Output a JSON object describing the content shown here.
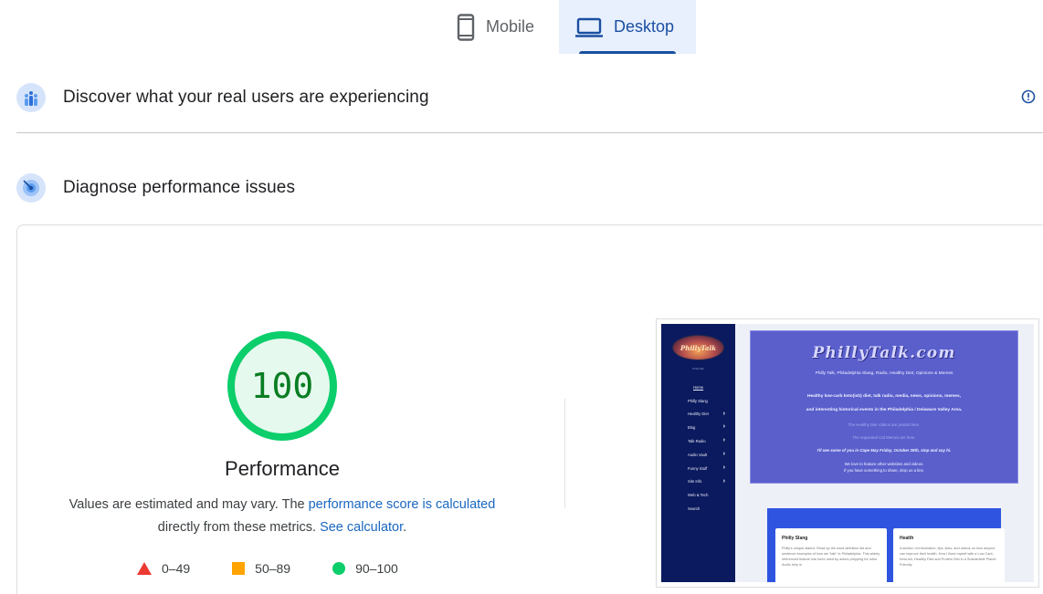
{
  "tabs": [
    {
      "label": "Mobile",
      "icon": "smartphone-icon",
      "active": false
    },
    {
      "label": "Desktop",
      "icon": "laptop-icon",
      "active": true
    }
  ],
  "sections": {
    "discover": {
      "title": "Discover what your real users are experiencing",
      "icon": "crux-users-icon"
    },
    "diagnose": {
      "title": "Diagnose performance issues",
      "icon": "lighthouse-radar-icon"
    }
  },
  "performance": {
    "score": "100",
    "title": "Performance",
    "desc_prefix": "Values are estimated and may vary. The ",
    "score_link": "performance score is calculated",
    "desc_middle": "directly from these metrics. ",
    "calc_link": "See calculator",
    "desc_suffix": "."
  },
  "legend": [
    {
      "range": "0–49",
      "shape": "triangle",
      "color": "#eb3a32"
    },
    {
      "range": "50–89",
      "shape": "square",
      "color": "#ffa400"
    },
    {
      "range": "90–100",
      "shape": "circle",
      "color": "#0cce6b"
    }
  ],
  "colors": {
    "accent": "#1a4fa1",
    "pass": "#0cce6b",
    "pass_text": "#0a7d22",
    "average": "#ffa400",
    "fail": "#eb3a32"
  },
  "site_preview": {
    "logo_text": "PhillyTalk",
    "logo_sub": "PhillyTalk",
    "nav": [
      {
        "label": "Home",
        "chevron": false
      },
      {
        "label": "Philly Slang",
        "chevron": false
      },
      {
        "label": "Healthy Diet",
        "chevron": true
      },
      {
        "label": "Blog",
        "chevron": true
      },
      {
        "label": "Talk Radio",
        "chevron": true
      },
      {
        "label": "Audio Vault",
        "chevron": true
      },
      {
        "label": "Funny Stuff",
        "chevron": true
      },
      {
        "label": "Site Info",
        "chevron": true
      },
      {
        "label": "Web & Tech",
        "chevron": false
      },
      {
        "label": "Search",
        "chevron": false
      }
    ],
    "hero_title": "PhillyTalk.com",
    "hero_subtitle": "Philly Talk, Philadelphia Slang, Radio, Healthy Diet, Opinions & Memes",
    "hero_bold_1": "Healthy low-carb keto(ish) diet, talk radio, media, news, opinions, memes,",
    "hero_bold_2": "and interesting historical events in the Philadelphia / Delaware Valley Area.",
    "hero_link_1": "The Healthy Diet Videos are posted here.",
    "hero_link_2": "The requested Cat Memes are here.",
    "hero_italic": "I'll see some of you in Cape May Friday, October 28th, stop and say hi.",
    "hero_contact_1": "We love to feature other websites and videos.",
    "hero_contact_2": "If you have something to share, drop us a line.",
    "cards": [
      {
        "title": "Philly Slang",
        "text": "Philly's unique dialect. Read up the word definition list and sentence examples of how we \"talk\" in Philadelphia. This widely referenced feature has been used by actors prepping for roles. Audio help is"
      },
      {
        "title": "Health",
        "text": "A section of information, tips, links, and videos on how anyone can improve their health. How I fixed myself with a Low Carb, Keto-ish, Healthy Fats and Protein Diet in a Sustainable Planet Friendly"
      }
    ]
  }
}
